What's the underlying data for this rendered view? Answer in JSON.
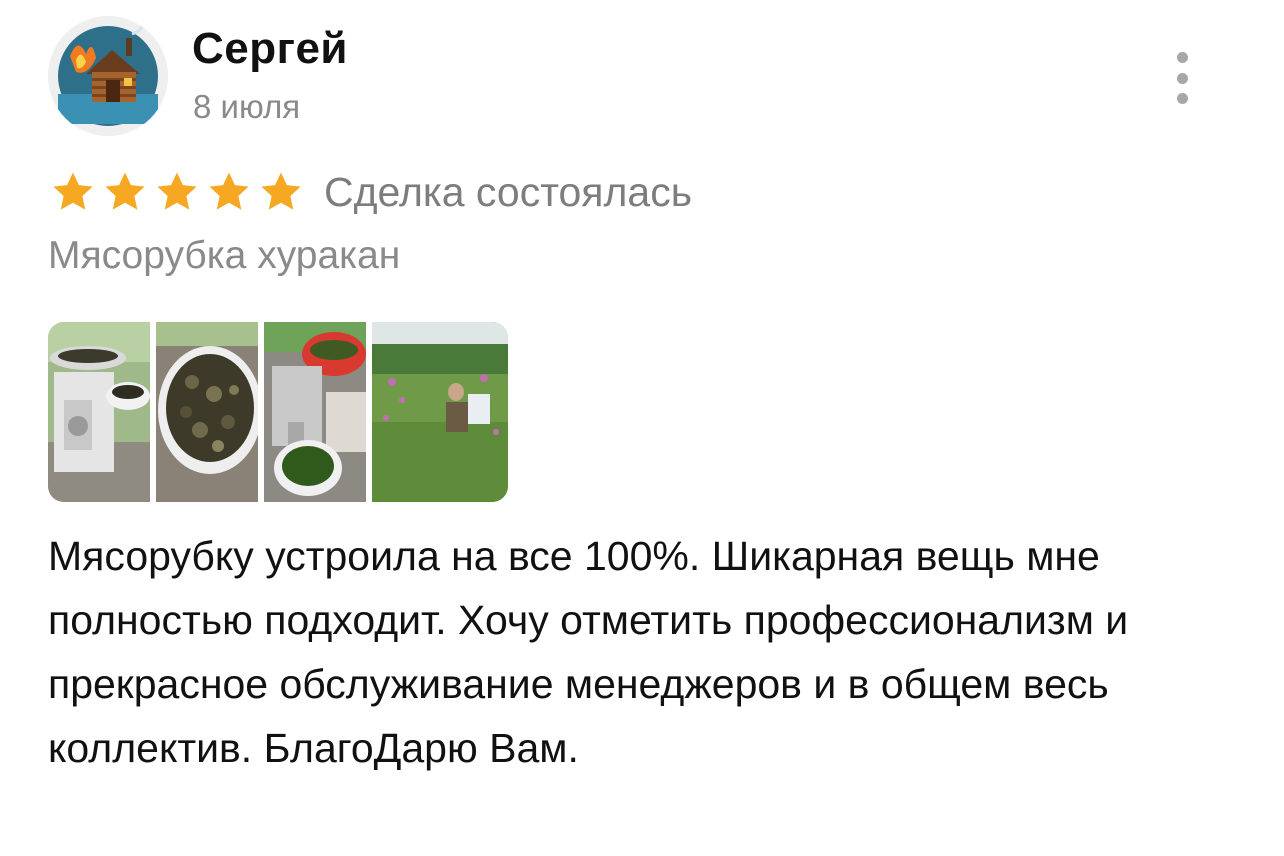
{
  "review": {
    "author": "Сергей",
    "date": "8 июля",
    "rating": 5,
    "rating_max": 5,
    "deal_status": "Сделка состоялась",
    "product": "Мясорубка хуракан",
    "text": "Мясорубку устроила на все 100%. Шикарная вещь мне полностью подходит. Хочу отметить профессионализм и прекрасное обслуживание менеджеров и в общем весь коллектив. БлагоДарю Вам."
  },
  "icons": {
    "avatar": "sauna-house-logo",
    "menu": "more-vertical-icon",
    "star": "star-icon"
  },
  "colors": {
    "star": "#F7A823",
    "secondary_text": "#8A8A8A",
    "primary_text": "#111111",
    "menu_dots": "#A7A7A7"
  },
  "photos": [
    {
      "subject": "meat-grinder-with-bowl"
    },
    {
      "subject": "bowl-of-fermented-leaves"
    },
    {
      "subject": "grinder-output-green-leaves"
    },
    {
      "subject": "man-in-fireweed-field"
    }
  ]
}
